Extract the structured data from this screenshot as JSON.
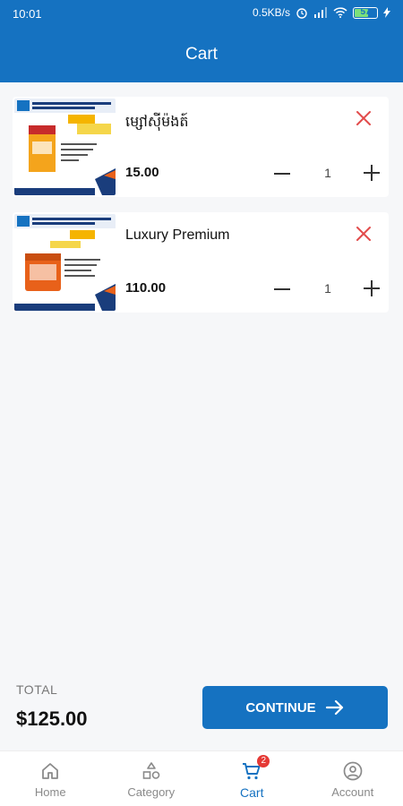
{
  "status_bar": {
    "time": "10:01",
    "network_speed": "0.5KB/s",
    "battery_level": "57"
  },
  "header": {
    "title": "Cart"
  },
  "cart": {
    "items": [
      {
        "name": "ម្សៅស៊ីម៉ងត៍",
        "price": "15.00",
        "quantity": "1"
      },
      {
        "name": "Luxury Premium",
        "price": "110.00",
        "quantity": "1"
      }
    ]
  },
  "footer": {
    "total_label": "TOTAL",
    "total_value": "$125.00",
    "continue_label": "CONTINUE"
  },
  "bottom_nav": {
    "items": [
      {
        "label": "Home",
        "icon": "home-icon"
      },
      {
        "label": "Category",
        "icon": "category-icon"
      },
      {
        "label": "Cart",
        "icon": "cart-icon",
        "badge": "2",
        "active": true
      },
      {
        "label": "Account",
        "icon": "account-icon"
      }
    ]
  },
  "colors": {
    "primary": "#1572c1",
    "remove": "#e24b4b",
    "badge": "#e53935"
  }
}
